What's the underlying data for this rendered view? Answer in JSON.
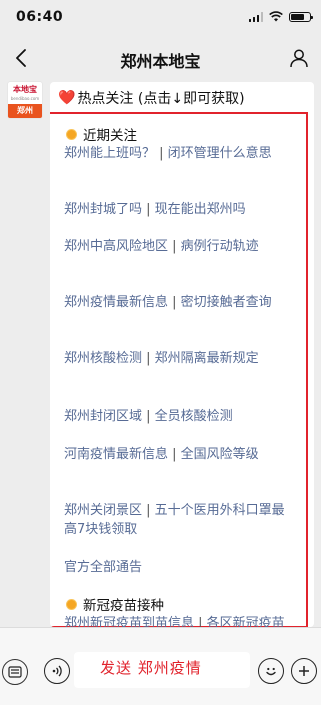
{
  "status": {
    "time": "06:40"
  },
  "nav": {
    "title": "郑州本地宝"
  },
  "avatar": {
    "logo": "本地宝",
    "logo_sub": "bendibao.com",
    "city": "郑州"
  },
  "hot": {
    "heart": "❤️",
    "label": "热点关注 (点击↓即可获取)"
  },
  "sections": [
    {
      "title": "近期关注"
    },
    {
      "title": "新冠疫苗接种"
    }
  ],
  "links": [
    [
      "郑州能上班吗？",
      "闭环管理什么意思"
    ],
    [
      "郑州封城了吗",
      "现在能出郑州吗"
    ],
    [
      "郑州中高风险地区",
      "病例行动轨迹"
    ],
    [
      "郑州疫情最新信息",
      "密切接触者查询"
    ],
    [
      "郑州核酸检测",
      "郑州隔离最新规定"
    ],
    [
      "郑州封闭区域",
      "全员核酸检测"
    ],
    [
      "河南疫情最新信息",
      "全国风险等级"
    ],
    [
      "郑州关闭景区",
      "五十个医用外科口罩最高7块钱领取"
    ],
    [
      "官方全部通告"
    ],
    [
      "郑州新冠疫苗到苗信息",
      "各区新冠疫苗信息"
    ]
  ],
  "separator": " | ",
  "input": {
    "hint": "发送  郑州疫情"
  },
  "colors": {
    "accent_red": "#e1232c",
    "link_blue": "#576b95"
  }
}
